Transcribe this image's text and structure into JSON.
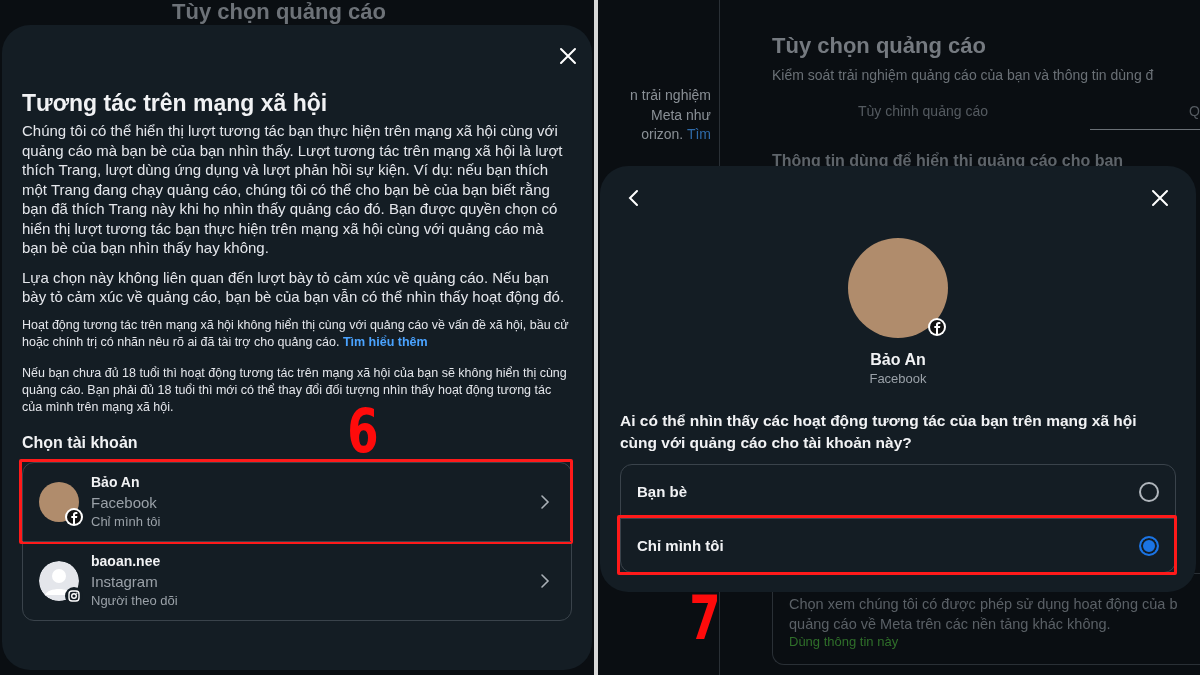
{
  "left_screen": {
    "background_title": "Tùy chọn quảng cáo",
    "dialog": {
      "title": "Tương tác trên mạng xã hội",
      "paragraphs": [
        {
          "kind": "body",
          "text": "Chúng tôi có thể hiển thị lượt tương tác bạn thực hiện trên mạng xã hội cùng với quảng cáo mà bạn bè của bạn nhìn thấy. Lượt tương tác trên mạng xã hội là lượt thích Trang, lượt dùng ứng dụng và lượt phản hồi sự kiện. Ví dụ: nếu bạn thích một Trang đang chạy quảng cáo, chúng tôi có thể cho bạn bè của bạn biết rằng bạn đã thích Trang này khi họ nhìn thấy quảng cáo đó. Bạn được quyền chọn có hiển thị lượt tương tác bạn thực hiện trên mạng xã hội cùng với quảng cáo mà bạn bè của bạn nhìn thấy hay không."
        },
        {
          "kind": "body",
          "text": "Lựa chọn này không liên quan đến lượt bày tỏ cảm xúc về quảng cáo. Nếu bạn bày tỏ cảm xúc về quảng cáo, bạn bè của bạn vẫn có thể nhìn thấy hoạt động đó."
        },
        {
          "kind": "small",
          "text": "Hoạt động tương tác trên mạng xã hội không hiển thị cùng với quảng cáo về vấn đề xã hội, bầu cử hoặc chính trị có nhãn nêu rõ ai đã tài trợ cho quảng cáo.",
          "link": "Tìm hiểu thêm"
        },
        {
          "kind": "small",
          "text": "Nếu bạn chưa đủ 18 tuổi thì hoạt động tương tác trên mạng xã hội của bạn sẽ không hiển thị cùng quảng cáo. Bạn phải đủ 18 tuổi thì mới có thể thay đổi đối tượng nhìn thấy hoạt động tương tác của mình trên mạng xã hội."
        }
      ],
      "section_title": "Chọn tài khoản",
      "accounts": [
        {
          "kind": "facebook",
          "name": "Bảo An",
          "platform": "Facebook",
          "audience": "Chỉ mình tôi",
          "highlighted": true
        },
        {
          "kind": "instagram",
          "name": "baoan.nee",
          "platform": "Instagram",
          "audience": "Người theo dõi",
          "highlighted": false
        }
      ],
      "step_label": "6"
    }
  },
  "right_screen": {
    "sidebar_lines": [
      {
        "text": "n trải nghiệm"
      },
      {
        "text": "Meta như"
      },
      {
        "text": "orizon.",
        "link": "Tìm"
      }
    ],
    "background_title": "Tùy chọn quảng cáo",
    "background_subtitle": "Kiểm soát trải nghiệm quảng cáo của bạn và thông tin dùng đ",
    "tabs": [
      {
        "label": "Tùy chỉnh quảng cáo",
        "selected": false
      },
      {
        "label": "Q",
        "selected": true
      }
    ],
    "section_heading": "Thông tin dùng để hiển thị quảng cáo cho bạn",
    "card": {
      "text": "Chọn xem chúng tôi có được phép sử dụng hoạt động của b quảng cáo về Meta trên các nền tảng khác không.",
      "status": "Dùng thông tin này"
    },
    "dialog": {
      "name": "Bảo An",
      "platform": "Facebook",
      "question": "Ai có thể nhìn thấy các hoạt động tương tác của bạn trên mạng xã hội cùng với quảng cáo cho tài khoản này?",
      "options": [
        {
          "label": "Bạn bè",
          "selected": false,
          "highlighted": false
        },
        {
          "label": "Chỉ mình tôi",
          "selected": true,
          "highlighted": true
        }
      ]
    },
    "step_label": "7"
  }
}
